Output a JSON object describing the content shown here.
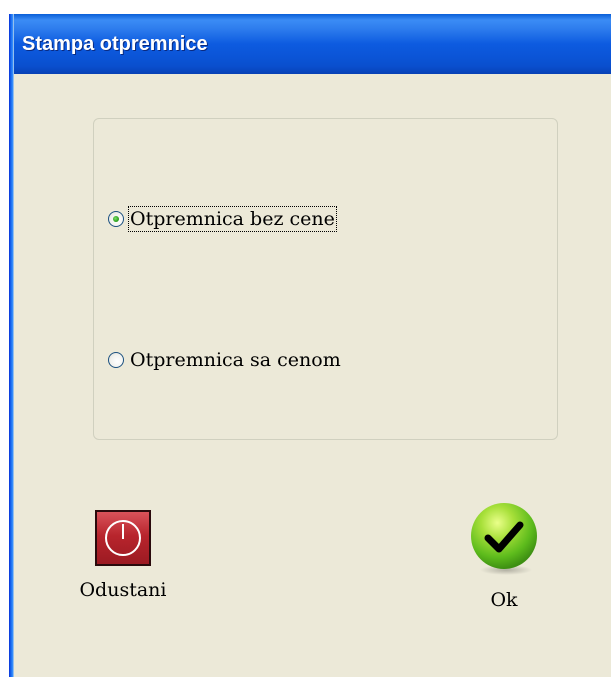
{
  "window": {
    "title": "Stampa otpremnice"
  },
  "options": {
    "without_price": {
      "label": "Otpremnica bez cene",
      "checked": true
    },
    "with_price": {
      "label": "Otpremnica sa cenom",
      "checked": false
    }
  },
  "buttons": {
    "cancel": {
      "label": "Odustani",
      "icon": "power-icon"
    },
    "ok": {
      "label": "Ok",
      "icon": "checkmark-icon"
    }
  },
  "colors": {
    "titlebar": "#0b54d6",
    "window_background": "#ece9d8",
    "cancel_icon": "#b8252d",
    "ok_icon": "#5dbb1c"
  }
}
